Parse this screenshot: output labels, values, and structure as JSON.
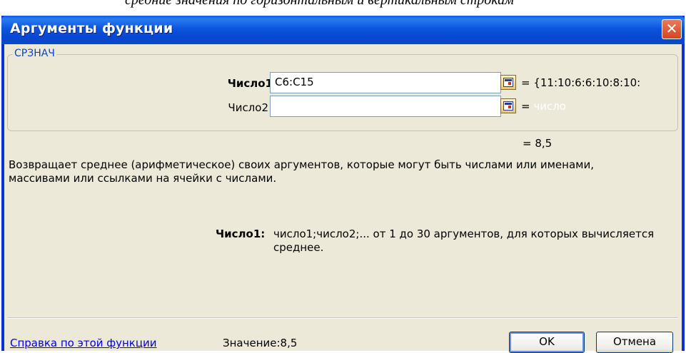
{
  "document": {
    "caption": "средние значения по горизонтальным и вертикальным строкам"
  },
  "dialog": {
    "title": "Аргументы функции",
    "close_icon": "close-icon",
    "function_name": "СРЗНАЧ",
    "args": [
      {
        "label": "Число1",
        "value": "C6:C15",
        "result": "= {11:10:6:6:10:8:10:"
      },
      {
        "label": "Число2",
        "value": "",
        "result_prefix": "=",
        "result_hint": "число"
      }
    ],
    "formula_result": "= 8,5",
    "description": "Возвращает среднее (арифметическое) своих аргументов, которые могут быть числами или именами, массивами или ссылками на ячейки с числами.",
    "arg_help_label": "Число1:",
    "arg_help_text": "число1;число2;... от 1 до 30 аргументов, для которых вычисляется среднее.",
    "help_link": "Справка по этой функции",
    "value_text": "Значение:8,5",
    "ok_label": "OK",
    "cancel_label": "Отмена",
    "ref_icon": "collapse-dialog-icon"
  }
}
